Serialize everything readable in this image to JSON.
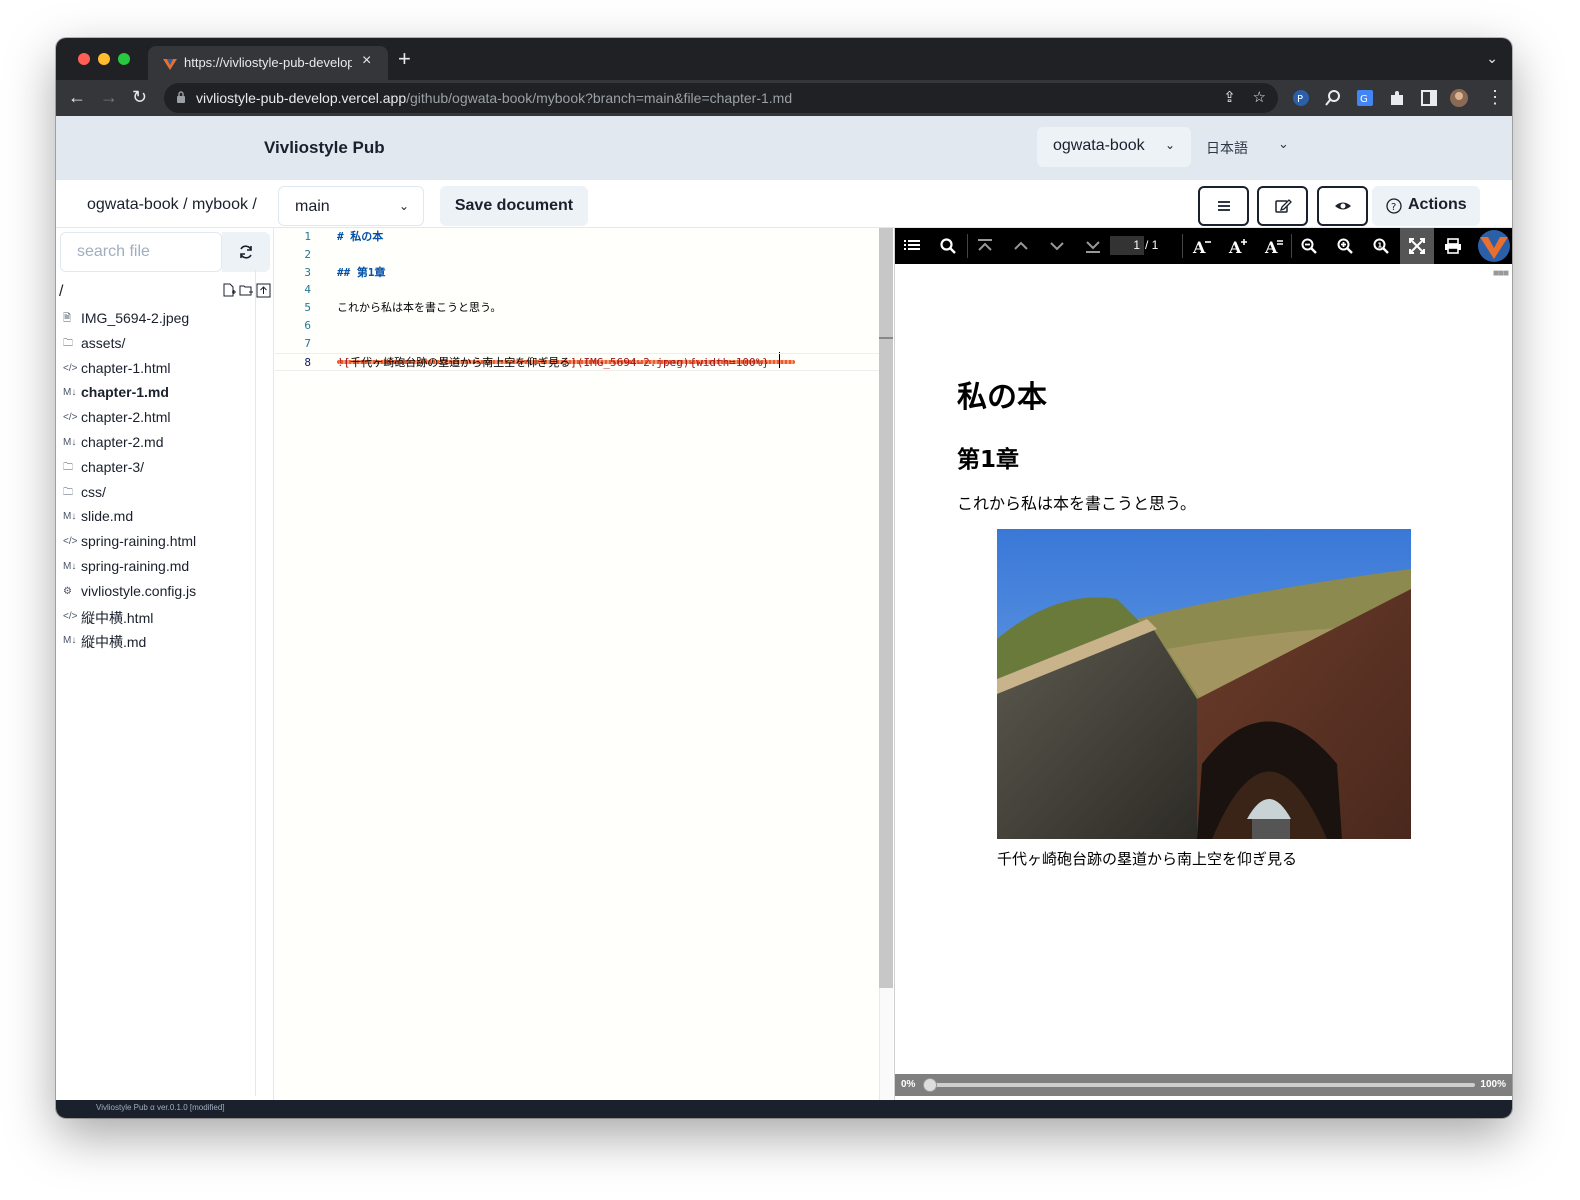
{
  "browser": {
    "tab_title": "https://vivliostyle-pub-develop.vercel.app/github/ogwata-book/mybook?branch=main&file=chapter-1.md",
    "url_host": "vivliostyle-pub-develop.vercel.app",
    "url_path": "/github/ogwata-book/mybook?branch=main&file=chapter-1.md",
    "colors": {
      "chrome_dark": "#202124",
      "chrome_toolbar": "#35363a"
    }
  },
  "header": {
    "brand": "Vivliostyle Pub",
    "user": "ogwata-book",
    "language": "日本語"
  },
  "subbar": {
    "breadcrumb": "ogwata-book / mybook /",
    "branch": "main",
    "save_label": "Save document",
    "actions_label": "Actions"
  },
  "sidebar": {
    "search_placeholder": "search file",
    "root": "/",
    "files": [
      {
        "name": "IMG_5694-2.jpeg",
        "icon": "image-file-icon",
        "glyph": "🗎",
        "active": false
      },
      {
        "name": "assets/",
        "icon": "folder-icon",
        "glyph": "🗀",
        "active": false
      },
      {
        "name": "chapter-1.html",
        "icon": "code-file-icon",
        "glyph": "</>",
        "active": false
      },
      {
        "name": "chapter-1.md",
        "icon": "markdown-icon",
        "glyph": "M↓",
        "active": true
      },
      {
        "name": "chapter-2.html",
        "icon": "code-file-icon",
        "glyph": "</>",
        "active": false
      },
      {
        "name": "chapter-2.md",
        "icon": "markdown-icon",
        "glyph": "M↓",
        "active": false
      },
      {
        "name": "chapter-3/",
        "icon": "folder-icon",
        "glyph": "🗀",
        "active": false
      },
      {
        "name": "css/",
        "icon": "folder-icon",
        "glyph": "🗀",
        "active": false
      },
      {
        "name": "slide.md",
        "icon": "markdown-icon",
        "glyph": "M↓",
        "active": false
      },
      {
        "name": "spring-raining.html",
        "icon": "code-file-icon",
        "glyph": "</>",
        "active": false
      },
      {
        "name": "spring-raining.md",
        "icon": "markdown-icon",
        "glyph": "M↓",
        "active": false
      },
      {
        "name": "vivliostyle.config.js",
        "icon": "gear-icon",
        "glyph": "⚙",
        "active": false
      },
      {
        "name": "縦中横.html",
        "icon": "code-file-icon",
        "glyph": "</>",
        "active": false
      },
      {
        "name": "縦中横.md",
        "icon": "markdown-icon",
        "glyph": "M↓",
        "active": false
      }
    ]
  },
  "editor": {
    "lines": [
      {
        "no": "1",
        "text": "# 私の本",
        "kind": "heading"
      },
      {
        "no": "2",
        "text": "",
        "kind": "text"
      },
      {
        "no": "3",
        "text": "## 第1章",
        "kind": "heading"
      },
      {
        "no": "4",
        "text": "",
        "kind": "text"
      },
      {
        "no": "5",
        "text": "これから私は本を書こうと思う。",
        "kind": "text"
      },
      {
        "no": "6",
        "text": "",
        "kind": "text"
      },
      {
        "no": "7",
        "text": "",
        "kind": "text"
      },
      {
        "no": "8",
        "text": "![千代ヶ崎砲台跡の塁道から南上空を仰ぎ見る](IMG_5694-2.jpeg){width=100%}",
        "kind": "image",
        "alt": "千代ヶ崎砲台跡の塁道から南上空を仰ぎ見る",
        "target": "](IMG_5694-2.jpeg){width=100%}"
      }
    ]
  },
  "preview": {
    "page_current": "1",
    "page_total": "/ 1",
    "h1": "私の本",
    "h2": "第1章",
    "paragraph": "これから私は本を書こうと思う。",
    "caption": "千代ヶ崎砲台跡の塁道から南上空を仰ぎ見る",
    "progress_min": "0%",
    "progress_max": "100%",
    "progress_value": 0.0
  },
  "status": "Vivliostyle Pub α ver.0.1.0 [modified]"
}
